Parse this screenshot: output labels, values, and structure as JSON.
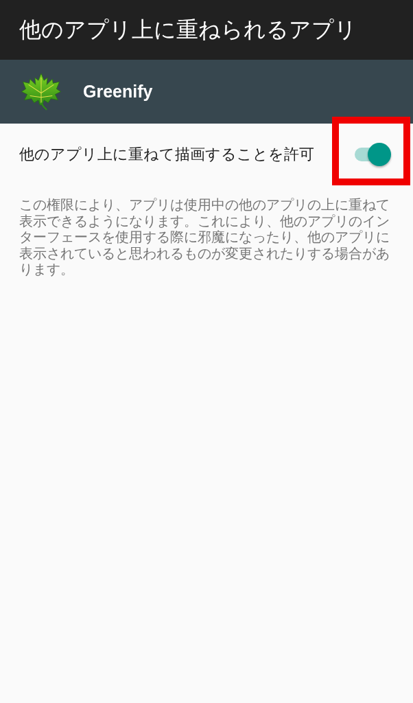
{
  "app_bar": {
    "title": "他のアプリ上に重ねられるアプリ"
  },
  "app_header": {
    "name": "Greenify"
  },
  "settings": [
    {
      "kind": "switch",
      "label": "他のアプリ上に重ねて描画することを許可",
      "on": true,
      "highlighted": true
    }
  ],
  "description": "この権限により、アプリは使用中の他のアプリの上に重ねて表示できるようになります。これにより、他のアプリのインターフェースを使用する際に邪魔になったり、他のアプリに表示されていると思われるものが変更されたりする場合があります。"
}
